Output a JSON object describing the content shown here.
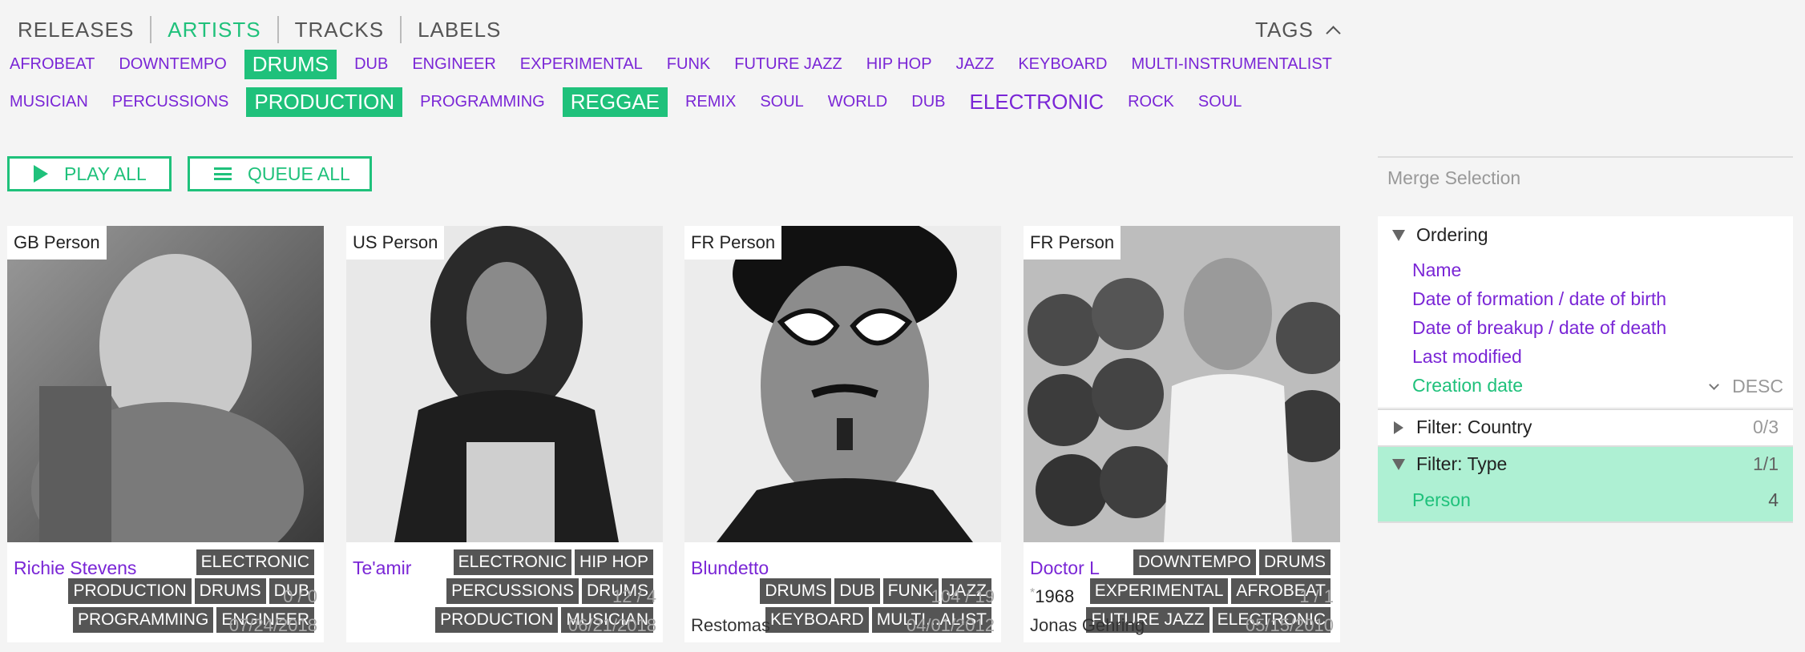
{
  "nav": {
    "items": [
      "RELEASES",
      "ARTISTS",
      "TRACKS",
      "LABELS"
    ],
    "active": "ARTISTS",
    "tags_label": "TAGS"
  },
  "tags": {
    "row1": [
      {
        "label": "AFROBEAT",
        "selected": false
      },
      {
        "label": "DOWNTEMPO",
        "selected": false
      },
      {
        "label": "DRUMS",
        "selected": true
      },
      {
        "label": "DUB",
        "selected": false
      },
      {
        "label": "ENGINEER",
        "selected": false
      },
      {
        "label": "EXPERIMENTAL",
        "selected": false
      },
      {
        "label": "FUNK",
        "selected": false
      },
      {
        "label": "FUTURE JAZZ",
        "selected": false
      },
      {
        "label": "HIP HOP",
        "selected": false
      },
      {
        "label": "JAZZ",
        "selected": false
      },
      {
        "label": "KEYBOARD",
        "selected": false
      },
      {
        "label": "MULTI-INSTRUMENTALIST",
        "selected": false
      }
    ],
    "row2": [
      {
        "label": "MUSICIAN",
        "selected": false
      },
      {
        "label": "PERCUSSIONS",
        "selected": false
      },
      {
        "label": "PRODUCTION",
        "selected": true
      },
      {
        "label": "PROGRAMMING",
        "selected": false
      },
      {
        "label": "REGGAE",
        "selected": true
      },
      {
        "label": "REMIX",
        "selected": false
      },
      {
        "label": "SOUL",
        "selected": false
      },
      {
        "label": "WORLD",
        "selected": false
      },
      {
        "label": "DUB",
        "selected": false
      },
      {
        "label": "ELECTRONIC",
        "selected": false,
        "large": true
      },
      {
        "label": "ROCK",
        "selected": false
      },
      {
        "label": "SOUL",
        "selected": false
      }
    ]
  },
  "actions": {
    "play_all": "PLAY ALL",
    "queue_all": "QUEUE ALL"
  },
  "cards": [
    {
      "origin": "GB Person",
      "tags": [
        "DRUMS",
        "DUB",
        "ELECTRONIC",
        "ENGINEER",
        "PRODUCTION",
        "PROGRAMMING"
      ],
      "name": "Richie Stevens",
      "counts": "0 / 0",
      "birth": "",
      "subname": "",
      "date": "07/24/2018"
    },
    {
      "origin": "US Person",
      "tags": [
        "DRUMS",
        "ELECTRONIC",
        "HIP HOP",
        "MUSICIAN",
        "PERCUSSIONS",
        "PRODUCTION"
      ],
      "name": "Te'amir",
      "counts": "12 / 4",
      "birth": "",
      "subname": "",
      "date": "06/21/2018"
    },
    {
      "origin": "FR Person",
      "tags": [
        "DRUMS",
        "DUB",
        "FUNK",
        "JAZZ",
        "KEYBOARD",
        "MULTI...ALIST"
      ],
      "name": "Blundetto",
      "counts": "104 / 19",
      "birth": "",
      "subname": "Restomas",
      "date": "04/01/2012"
    },
    {
      "origin": "FR Person",
      "tags": [
        "AFROBEAT",
        "DOWNTEMPO",
        "DRUMS",
        "ELECTRONIC",
        "EXPERIMENTAL",
        "FUTURE JAZZ"
      ],
      "name": "Doctor L",
      "counts": "1 / 1",
      "birth_star": "*",
      "birth": "1968",
      "subname": "Jonas Gehring",
      "date": "05/15/2010"
    }
  ],
  "panel": {
    "merge": "Merge Selection",
    "ordering": {
      "title": "Ordering",
      "items": [
        "Name",
        "Date of formation / date of birth",
        "Date of breakup / date of death",
        "Last modified",
        "Creation date"
      ],
      "selected": "Creation date",
      "direction": "DESC"
    },
    "filter_country": {
      "title": "Filter: Country",
      "count": "0/3"
    },
    "filter_type": {
      "title": "Filter: Type",
      "count": "1/1",
      "item": "Person",
      "item_count": "4"
    }
  },
  "colors": {
    "accent": "#1fc17b",
    "link": "#7a26d6",
    "highlight": "#aef0d3"
  }
}
